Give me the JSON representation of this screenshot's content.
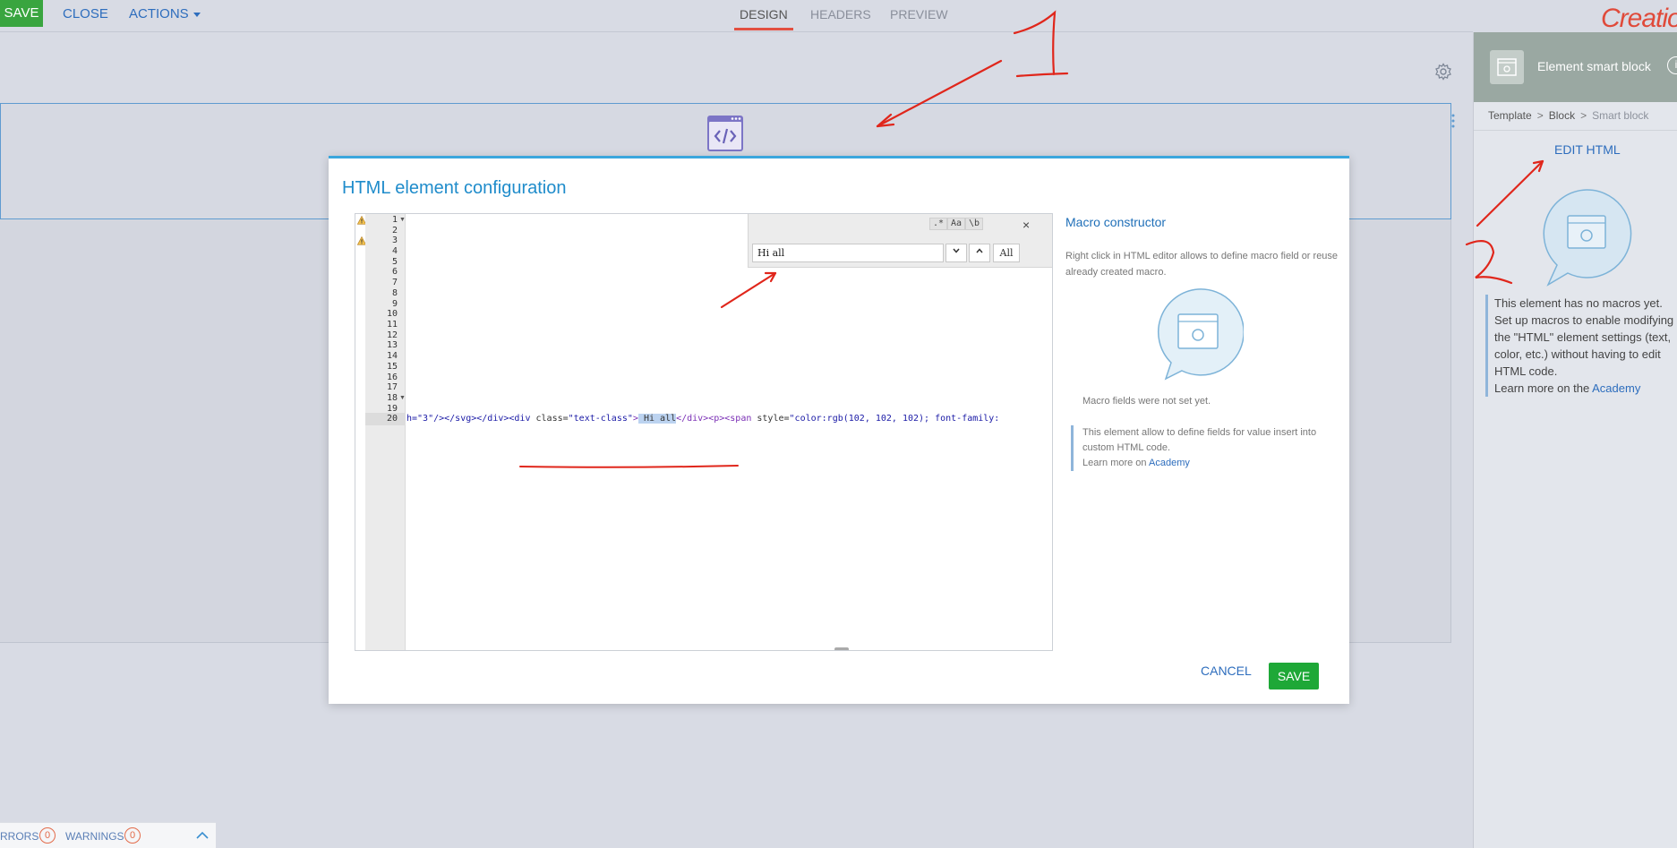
{
  "toolbar": {
    "save_label": "SAVE",
    "close_label": "CLOSE",
    "actions_label": "ACTIONS",
    "tabs": [
      {
        "label": "DESIGN"
      },
      {
        "label": "HEADERS"
      },
      {
        "label": "PREVIEW"
      }
    ],
    "logo_text": "Creatio"
  },
  "status_bar": {
    "errors_label": "RRORS",
    "errors_count": "0",
    "warnings_label": "WARNINGS",
    "warnings_count": "0"
  },
  "right_panel": {
    "title": "Element smart block",
    "info_icon_label": "i",
    "breadcrumb": [
      "Template",
      "Block",
      "Smart block"
    ],
    "breadcrumb_sep": ">",
    "edit_html_label": "EDIT HTML",
    "note_text": "This element has no macros yet. Set up macros to enable modifying the \"HTML\" element settings (text, color, etc.) without having to edit HTML code.",
    "learn_more_prefix": "Learn more on the",
    "learn_more_link": "Academy"
  },
  "modal": {
    "title": "HTML element configuration",
    "line_numbers": [
      "1",
      "2",
      "3",
      "4",
      "5",
      "6",
      "7",
      "8",
      "9",
      "10",
      "11",
      "12",
      "13",
      "14",
      "15",
      "16",
      "17",
      "18",
      "19",
      "20"
    ],
    "code_line_20": {
      "p1": "h=\"3\"/></svg></div><div",
      "p2": " class=",
      "p3": "\"text-class\"",
      "p4": ">",
      "p5": " Hi all",
      "p6": "</div><p><span",
      "p7": " style=",
      "p8": "\"color:rgb(102, 102, 102); font-family:"
    },
    "search": {
      "value": "Hi all",
      "opt_regex": ".*",
      "opt_case": "Aa",
      "opt_word": "\\b",
      "close_label": "×",
      "next_label": "⌄",
      "prev_label": "⌃",
      "all_label": "All"
    },
    "macro": {
      "title": "Macro constructor",
      "description": "Right click in HTML editor allows to define macro field or reuse already created macro.",
      "empty_text": "Macro fields were not set yet.",
      "note_text": "This element allow to define fields for value insert into custom HTML code.",
      "learn_more_prefix": "Learn more on",
      "learn_more_link": "Academy"
    },
    "cancel_label": "CANCEL",
    "save_label": "SAVE"
  },
  "colors": {
    "accent_blue": "#1f8ccb",
    "save_green": "#1ea837",
    "annotation_red": "#e0261b"
  }
}
